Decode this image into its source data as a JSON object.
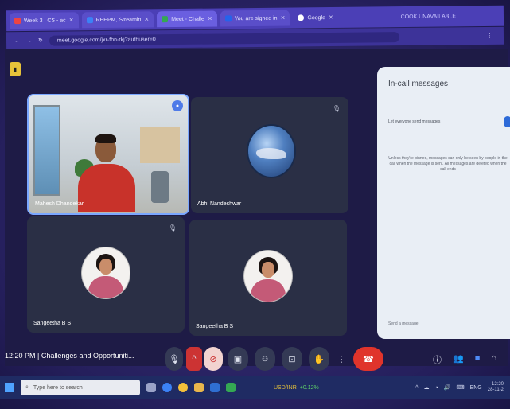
{
  "browser": {
    "tabs": [
      {
        "label": "Week 3 | CS - ac",
        "active": false
      },
      {
        "label": "REEPM, Streamin",
        "active": false
      },
      {
        "label": "Meet - Challe",
        "active": true
      },
      {
        "label": "You are signed in",
        "active": false
      },
      {
        "label": "Google",
        "active": false
      }
    ],
    "cookie_notice": "COOK UNAVAILABLE",
    "url": "meet.google.com/jxr-fhn-rkj?authuser=0"
  },
  "meet": {
    "participants": [
      {
        "name": "Mahesh Dhandekar"
      },
      {
        "name": "Abhi Nandeshwar"
      },
      {
        "name": "Sangeetha B S"
      },
      {
        "name": "Sangeetha B S"
      }
    ],
    "time": "12:20 PM",
    "separator": "|",
    "meeting_title": "Challenges and Opportuniti...",
    "controls": {
      "mic_icon": "mic-icon",
      "cam_icon": "camera-off-icon",
      "end_icon": "phone-end-icon"
    }
  },
  "panel": {
    "title": "In-call messages",
    "toggle_label": "Let everyone send messages",
    "info": "Unless they're pinned, messages can only be seen by people in the call when the message is sent. All messages are deleted when the call ends",
    "send_placeholder": "Send a message"
  },
  "taskbar": {
    "search_placeholder": "Type here to search",
    "stock_label": "USD/INR",
    "stock_change": "+0.12%",
    "lang": "ENG",
    "clock_time": "12:20",
    "clock_date": "28-11-2"
  },
  "colors": {
    "end_call": "#e0342b",
    "active_border": "#7aa7ff",
    "chat_icon": "#4f8cf7"
  }
}
